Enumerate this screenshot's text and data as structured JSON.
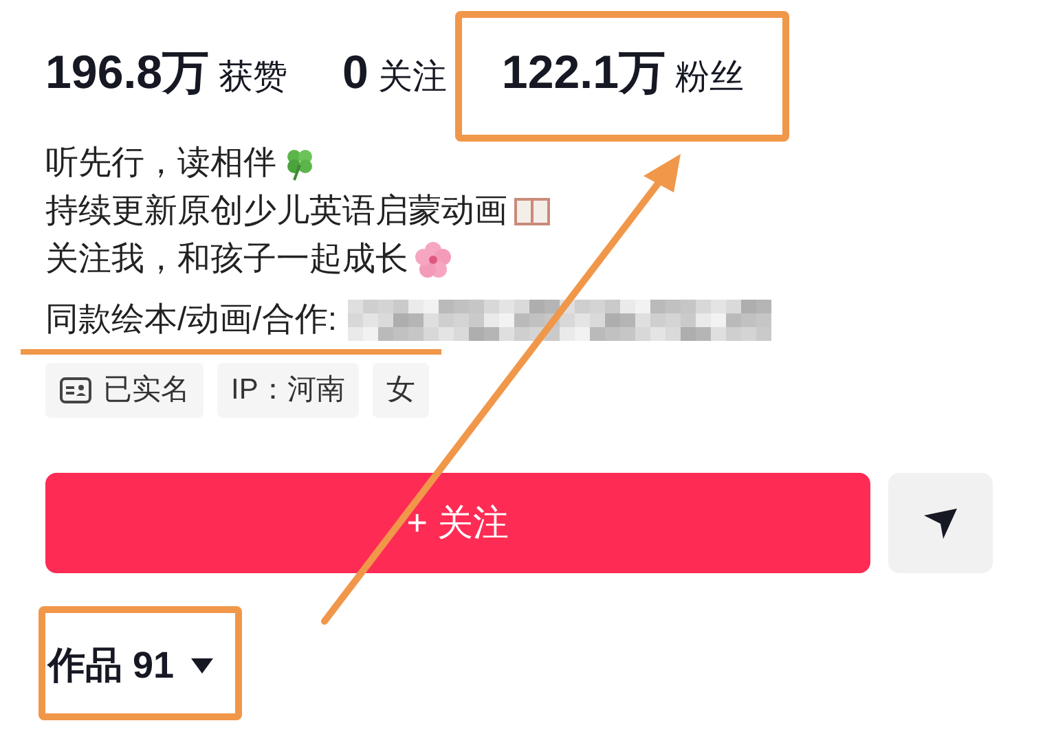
{
  "stats": [
    {
      "count": "196.8万",
      "caption": "获赞",
      "highlighted": false
    },
    {
      "count": "0",
      "caption": "关注",
      "highlighted": false
    },
    {
      "count": "122.1万",
      "caption": "粉丝",
      "highlighted": true
    }
  ],
  "bio": [
    {
      "text": "听先行，读相伴",
      "kind": "clover"
    },
    {
      "text": "持续更新原创少儿英语启蒙动画",
      "kind": "book"
    },
    {
      "text": "关注我，和孩子一起成长",
      "kind": "flower"
    },
    {
      "text": "同款绘本/动画/合作:",
      "kind": "redacted"
    }
  ],
  "bio_underline": true,
  "tags": [
    {
      "kind": "verified",
      "label": "已实名"
    },
    {
      "kind": "text",
      "label": "IP：河南"
    },
    {
      "kind": "text",
      "label": "女"
    }
  ],
  "follow_button": {
    "label": "+ 关注"
  },
  "works_tab": {
    "label": "作品 91",
    "highlighted": true
  },
  "annotation_arrow": true
}
